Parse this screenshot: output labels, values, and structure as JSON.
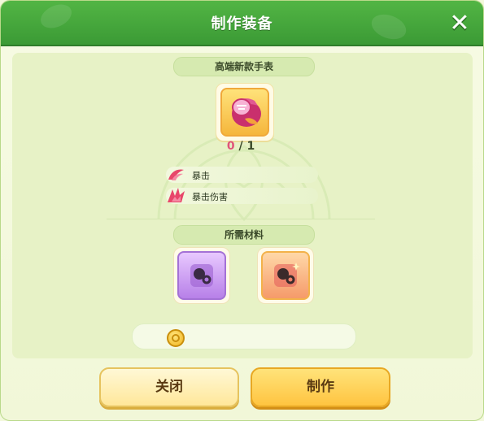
{
  "dialog": {
    "title": "制作装备",
    "close_icon": "close-icon"
  },
  "item": {
    "name": "高端新款手表",
    "icon": "watch-icon",
    "owned": "0",
    "separator": "/",
    "required": "1"
  },
  "attributes": [
    {
      "icon": "crit-icon",
      "label": "暴击"
    },
    {
      "icon": "crit-damage-icon",
      "label": "暴击伤害"
    }
  ],
  "materials": {
    "label": "所需材料",
    "items": [
      {
        "icon": "purple-material-icon",
        "rarity_color": "#b780e8"
      },
      {
        "icon": "orange-material-icon",
        "rarity_color": "#f59a6a"
      }
    ]
  },
  "cost": {
    "icon": "coin-icon",
    "amount": ""
  },
  "buttons": {
    "close_label": "关闭",
    "make_label": "制作"
  },
  "colors": {
    "header": "#3b9a35",
    "count_current": "#e0557a",
    "button_gold": "#ffc440"
  }
}
